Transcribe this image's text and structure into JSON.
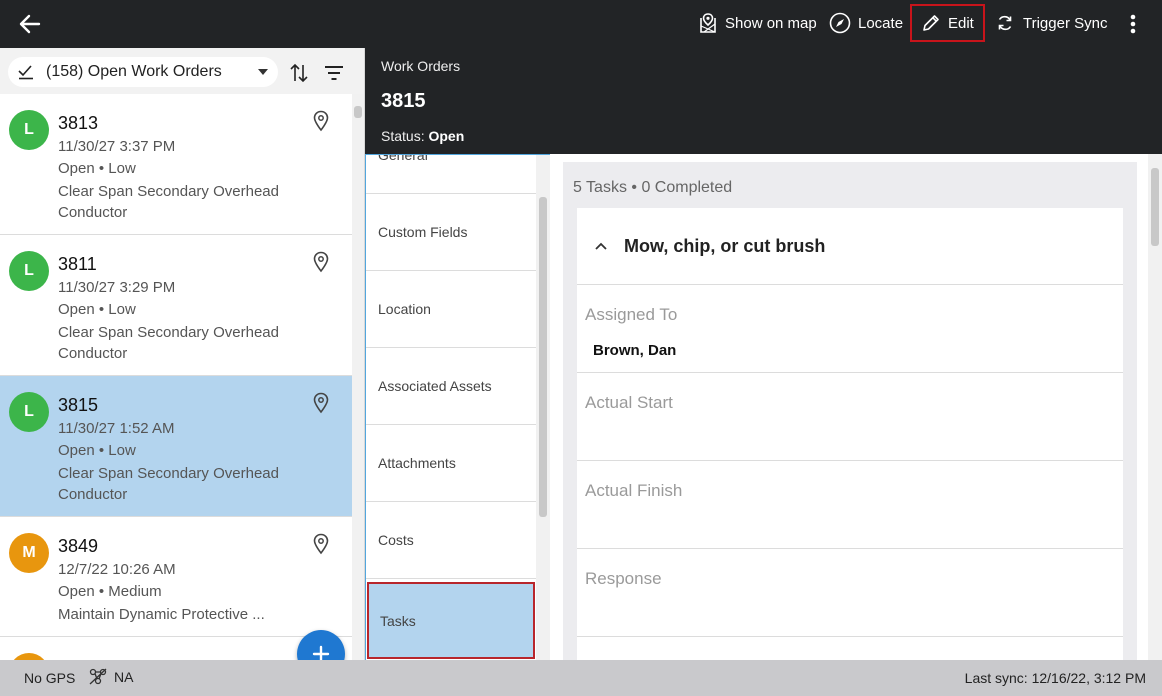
{
  "toolbar": {
    "show_on_map": "Show on map",
    "locate": "Locate",
    "edit": "Edit",
    "trigger_sync": "Trigger Sync"
  },
  "list": {
    "filter_label": "(158) Open Work Orders",
    "items": [
      {
        "avatar": "L",
        "avatar_color": "#3cb54a",
        "number": "3813",
        "date": "11/30/27 3:37 PM",
        "status": "Open • Low",
        "description": "Clear Span Secondary Overhead Conductor",
        "selected": false
      },
      {
        "avatar": "L",
        "avatar_color": "#3cb54a",
        "number": "3811",
        "date": "11/30/27 3:29 PM",
        "status": "Open • Low",
        "description": "Clear Span Secondary Overhead Conductor",
        "selected": false
      },
      {
        "avatar": "L",
        "avatar_color": "#3cb54a",
        "number": "3815",
        "date": "11/30/27 1:52 AM",
        "status": "Open • Low",
        "description": "Clear Span Secondary Overhead Conductor",
        "selected": true
      },
      {
        "avatar": "M",
        "avatar_color": "#e8960e",
        "number": "3849",
        "date": "12/7/22 10:26 AM",
        "status": "Open • Medium",
        "description": "Maintain Dynamic Protective ...",
        "selected": false
      }
    ],
    "partial_avatar_color": "#e8960e"
  },
  "detail": {
    "label": "Work Orders",
    "number": "3815",
    "status_prefix": "Status:",
    "status_value": "Open"
  },
  "sections": [
    "General",
    "Custom Fields",
    "Location",
    "Associated Assets",
    "Attachments",
    "Costs",
    "Tasks"
  ],
  "tasks": {
    "summary": "5 Tasks • 0 Completed",
    "title": "Mow, chip, or cut brush",
    "fields": [
      {
        "label": "Assigned To",
        "value": "Brown, Dan"
      },
      {
        "label": "Actual Start",
        "value": ""
      },
      {
        "label": "Actual Finish",
        "value": ""
      },
      {
        "label": "Response",
        "value": ""
      }
    ]
  },
  "statusbar": {
    "gps": "No GPS",
    "network": "NA",
    "last_sync": "Last sync: 12/16/22, 3:12 PM"
  },
  "colors": {
    "accent_blue": "#1f78d1",
    "selection_blue": "#b3d4ee",
    "highlight_red": "#c8141b",
    "header_dark": "#222426"
  }
}
